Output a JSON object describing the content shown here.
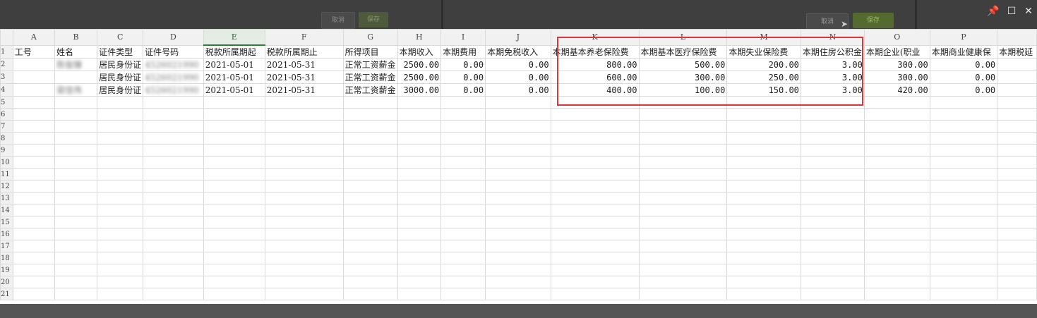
{
  "dialog": {
    "cancel_label": "取消",
    "save_label": "保存"
  },
  "window_controls": {
    "pin": "📌",
    "maximize": "☐",
    "close": "✕"
  },
  "columns": [
    "A",
    "B",
    "C",
    "D",
    "E",
    "F",
    "G",
    "H",
    "I",
    "J",
    "K",
    "L",
    "M",
    "N",
    "O",
    "P",
    ""
  ],
  "headers": [
    "工号",
    "姓名",
    "证件类型",
    "证件号码",
    "税款所属期起",
    "税款所属期止",
    "所得项目",
    "本期收入",
    "本期费用",
    "本期免税收入",
    "本期基本养老保险费",
    "本期基本医疗保险费",
    "本期失业保险费",
    "本期住房公积金",
    "本期企业(职业",
    "本期商业健康保",
    "本期税延"
  ],
  "rows": [
    [
      "",
      "陈俊臻",
      "居民身份证",
      "4526021990",
      "2021-05-01",
      "2021-05-31",
      "正常工资薪金",
      "2500.00",
      "0.00",
      "0.00",
      "800.00",
      "500.00",
      "200.00",
      "3.00",
      "300.00",
      "0.00",
      ""
    ],
    [
      "",
      "",
      "居民身份证",
      "4526021990",
      "2021-05-01",
      "2021-05-31",
      "正常工资薪金",
      "2500.00",
      "0.00",
      "0.00",
      "600.00",
      "300.00",
      "250.00",
      "3.00",
      "300.00",
      "0.00",
      ""
    ],
    [
      "",
      "梁佳伟",
      "居民身份证",
      "4526021990",
      "2021-05-01",
      "2021-05-31",
      "正常工资薪金",
      "3000.00",
      "0.00",
      "0.00",
      "400.00",
      "100.00",
      "150.00",
      "3.00",
      "420.00",
      "0.00",
      ""
    ]
  ],
  "row_numbers": [
    "1",
    "2",
    "3",
    "4",
    "5",
    "6",
    "7",
    "8",
    "9",
    "10",
    "11",
    "12",
    "13",
    "14",
    "15",
    "16",
    "17",
    "18",
    "19",
    "20",
    "21"
  ],
  "selected_column": "E",
  "highlight_color": "#e0343a"
}
